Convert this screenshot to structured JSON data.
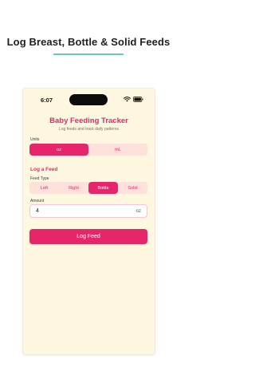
{
  "headline": "Log Breast, Bottle & Solid Feeds",
  "status_bar": {
    "time": "6:07"
  },
  "app": {
    "title": "Baby Feeding Tracker",
    "subtitle": "Log feeds and track daily patterns"
  },
  "units": {
    "label": "Units",
    "options": [
      "oz",
      "mL"
    ],
    "selected": "oz"
  },
  "log_feed": {
    "heading": "Log a Feed",
    "feed_type_label": "Feed Type",
    "feed_types": [
      "Left",
      "Right",
      "Bottle",
      "Solid"
    ],
    "selected_feed_type": "Bottle",
    "amount_label": "Amount",
    "amount_value": "4",
    "amount_unit": "oz",
    "button_label": "Log Feed"
  },
  "colors": {
    "accent": "#e6256b",
    "screen_background": "#fff8e0",
    "segment_background": "#fde1da",
    "headline_rule": "#6ccbc0"
  },
  "icons": [
    "wifi-icon",
    "battery-icon"
  ]
}
